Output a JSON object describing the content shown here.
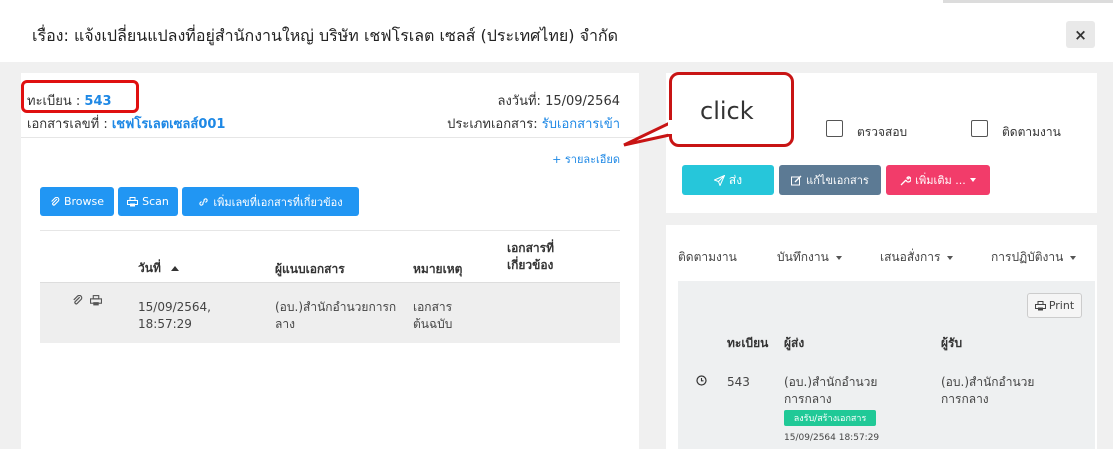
{
  "modal": {
    "title": "เรื่อง: แจ้งเปลี่ยนแปลงที่อยู่สำนักงานใหญ่ บริษัท เชฟโรเลต เซลส์ (ประเทศไทย) จำกัด",
    "close_label": "×"
  },
  "document": {
    "reg_label": "ทะเบียน : ",
    "reg_no": "543",
    "docno_label": "เอกสารเลขที่ : ",
    "docno": "เชฟโรเลตเซลส์001",
    "date_label": "ลงวันที่: 15/09/2564",
    "type_label": "ประเภทเอกสาร: ",
    "type_value": "รับเอกสารเข้า",
    "details_link": "+ รายละเอียด"
  },
  "buttons": {
    "browse": "Browse",
    "scan": "Scan",
    "add_related": "เพิ่มเลขที่เอกสารที่เกี่ยวข้อง"
  },
  "table": {
    "headers": [
      "วันที่",
      "ผู้แนบเอกสาร",
      "หมายเหตุ",
      "เอกสารที่เกี่ยวข้อง"
    ],
    "rows": [
      {
        "date": "15/09/2564, 18:57:29",
        "attacher": "(อบ.)สำนักอำนวยการกลาง",
        "note": "เอกสารต้นฉบับ",
        "related": ""
      }
    ]
  },
  "annotation": {
    "click_text": "click"
  },
  "actions": {
    "check_label": "ตรวจสอบ",
    "follow_label": "ติดตามงาน",
    "send": "ส่ง",
    "edit": "แก้ไขเอกสาร",
    "more": "เพิ่มเติม ..."
  },
  "tabs": [
    "ติดตามงาน",
    "บันทึกงาน",
    "เสนอสั่งการ",
    "การปฏิบัติงาน"
  ],
  "tracking": {
    "print_label": "Print",
    "headers": [
      "ทะเบียน",
      "ผู้ส่ง",
      "ผู้รับ"
    ],
    "rows": [
      {
        "reg": "543",
        "sender": "(อบ.)สำนักอำนวยการกลาง",
        "receiver": "(อบ.)สำนักอำนวยการกลาง",
        "badge": "ลงรับ/สร้างเอกสาร",
        "timestamp": "15/09/2564 18:57:29"
      }
    ]
  },
  "colors": {
    "link": "#1e88e5",
    "highlight": "#e01010",
    "send": "#26c6da",
    "edit": "#5c7a94",
    "more": "#f23c6a",
    "badge": "#20c997"
  }
}
